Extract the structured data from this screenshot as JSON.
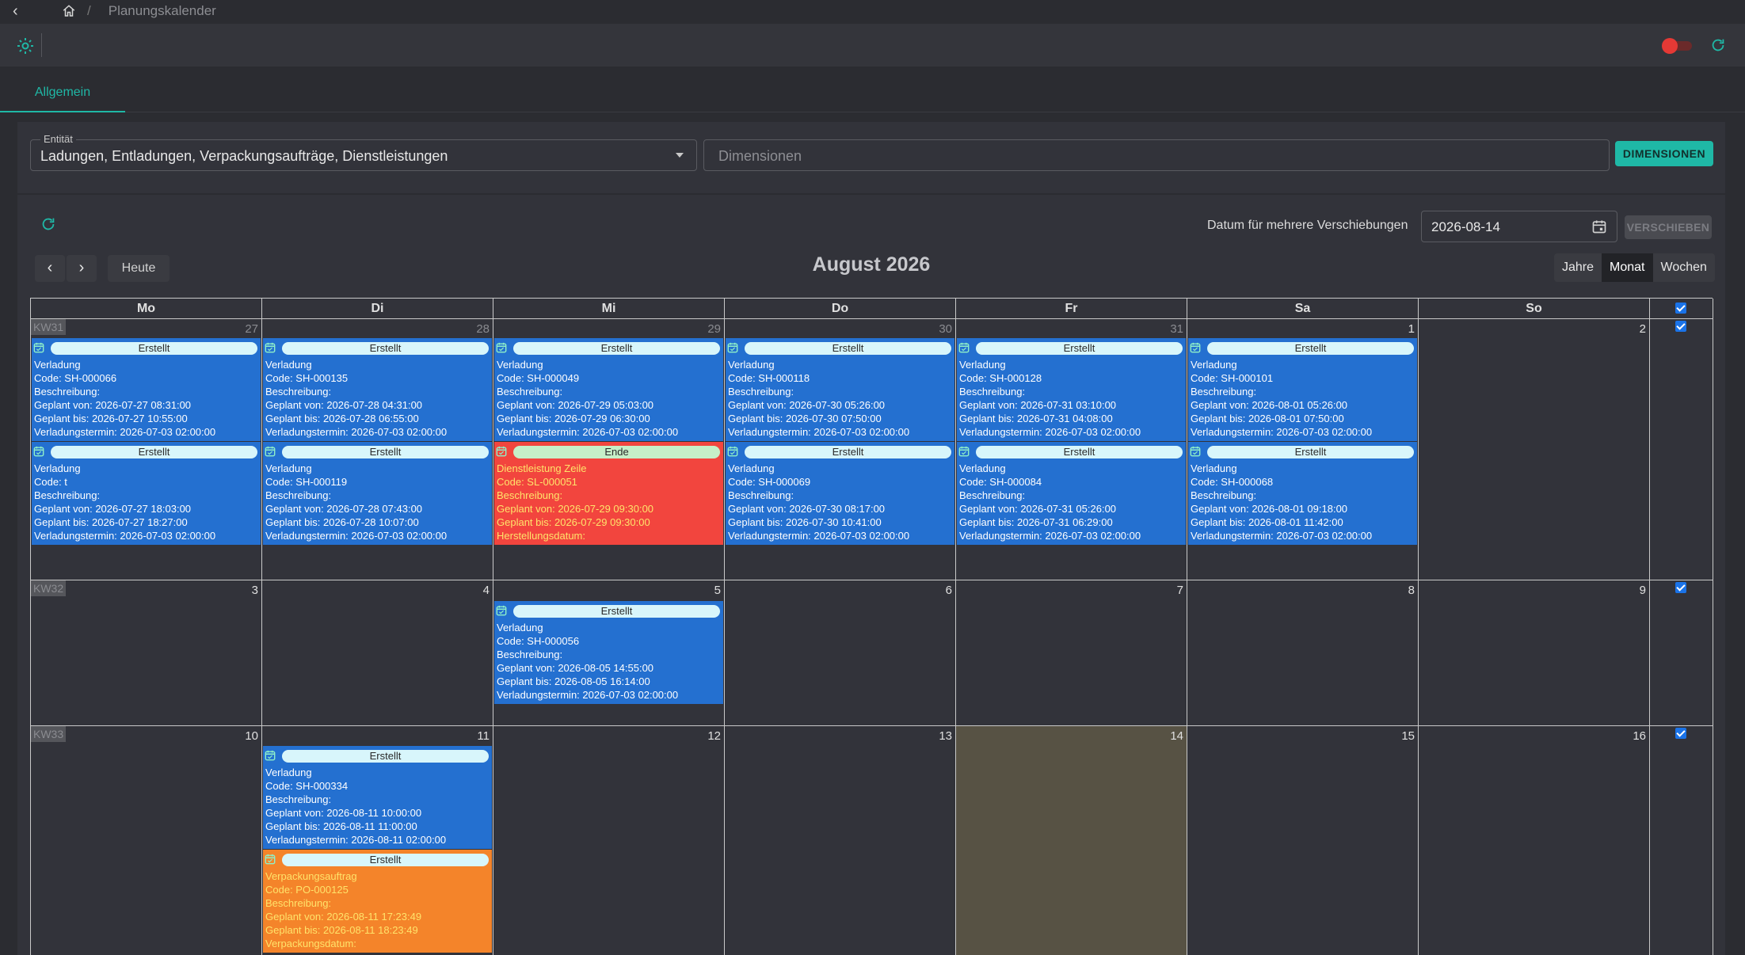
{
  "breadcrumb": {
    "current": "Planungskalender",
    "separator": "/"
  },
  "tabs": [
    {
      "label": "Allgemein",
      "active": true
    }
  ],
  "filters": {
    "entity_label": "Entität",
    "entity_value": "Ladungen, Entladungen, Verpackungsaufträge, Dienstleistungen",
    "dimensions_placeholder": "Dimensionen",
    "dimensions_button": "DIMENSIONEN"
  },
  "shift": {
    "label": "Datum für mehrere Verschiebungen",
    "date_value": "2026-08-14",
    "button": "VERSCHIEBEN"
  },
  "nav": {
    "today": "Heute",
    "title": "August 2026"
  },
  "views": [
    {
      "label": "Jahre"
    },
    {
      "label": "Monat",
      "active": true
    },
    {
      "label": "Wochen"
    }
  ],
  "weekdays": [
    "Mo",
    "Di",
    "Mi",
    "Do",
    "Fr",
    "Sa",
    "So"
  ],
  "weeks": [
    {
      "kw": "KW31",
      "days": [
        "27",
        "28",
        "29",
        "30",
        "31",
        "1",
        "2"
      ]
    },
    {
      "kw": "KW32",
      "days": [
        "3",
        "4",
        "5",
        "6",
        "7",
        "8",
        "9"
      ]
    },
    {
      "kw": "KW33",
      "days": [
        "10",
        "11",
        "12",
        "13",
        "14",
        "15",
        "16"
      ]
    }
  ],
  "events": [
    {
      "status": "Erstellt",
      "lines": [
        "Verladung",
        "Code: SH-000066",
        "Beschreibung:",
        "Geplant von: 2026-07-27 08:31:00",
        "Geplant bis: 2026-07-27 10:55:00",
        "Verladungstermin: 2026-07-03 02:00:00"
      ]
    },
    {
      "status": "Erstellt",
      "lines": [
        "Verladung",
        "Code: SH-000135",
        "Beschreibung:",
        "Geplant von: 2026-07-28 04:31:00",
        "Geplant bis: 2026-07-28 06:55:00",
        "Verladungstermin: 2026-07-03 02:00:00"
      ]
    },
    {
      "status": "Erstellt",
      "lines": [
        "Verladung",
        "Code: SH-000049",
        "Beschreibung:",
        "Geplant von: 2026-07-29 05:03:00",
        "Geplant bis: 2026-07-29 06:30:00",
        "Verladungstermin: 2026-07-03 02:00:00"
      ]
    },
    {
      "status": "Erstellt",
      "lines": [
        "Verladung",
        "Code: SH-000118",
        "Beschreibung:",
        "Geplant von: 2026-07-30 05:26:00",
        "Geplant bis: 2026-07-30 07:50:00",
        "Verladungstermin: 2026-07-03 02:00:00"
      ]
    },
    {
      "status": "Erstellt",
      "lines": [
        "Verladung",
        "Code: SH-000128",
        "Beschreibung:",
        "Geplant von: 2026-07-31 03:10:00",
        "Geplant bis: 2026-07-31 04:08:00",
        "Verladungstermin: 2026-07-03 02:00:00"
      ]
    },
    {
      "status": "Erstellt",
      "lines": [
        "Verladung",
        "Code: SH-000101",
        "Beschreibung:",
        "Geplant von: 2026-08-01 05:26:00",
        "Geplant bis: 2026-08-01 07:50:00",
        "Verladungstermin: 2026-07-03 02:00:00"
      ]
    },
    {
      "status": "Erstellt",
      "lines": [
        "Verladung",
        "Code: t",
        "Beschreibung:",
        "Geplant von: 2026-07-27 18:03:00",
        "Geplant bis: 2026-07-27 18:27:00",
        "Verladungstermin: 2026-07-03 02:00:00"
      ]
    },
    {
      "status": "Erstellt",
      "lines": [
        "Verladung",
        "Code: SH-000119",
        "Beschreibung:",
        "Geplant von: 2026-07-28 07:43:00",
        "Geplant bis: 2026-07-28 10:07:00",
        "Verladungstermin: 2026-07-03 02:00:00"
      ]
    },
    {
      "status": "Ende",
      "lines": [
        "Dienstleistung Zeile",
        "Code: SL-000051",
        "Beschreibung:",
        "Geplant von: 2026-07-29 09:30:00",
        "Geplant bis: 2026-07-29 09:30:00",
        "Herstellungsdatum:"
      ]
    },
    {
      "status": "Erstellt",
      "lines": [
        "Verladung",
        "Code: SH-000069",
        "Beschreibung:",
        "Geplant von: 2026-07-30 08:17:00",
        "Geplant bis: 2026-07-30 10:41:00",
        "Verladungstermin: 2026-07-03 02:00:00"
      ]
    },
    {
      "status": "Erstellt",
      "lines": [
        "Verladung",
        "Code: SH-000084",
        "Beschreibung:",
        "Geplant von: 2026-07-31 05:26:00",
        "Geplant bis: 2026-07-31 06:29:00",
        "Verladungstermin: 2026-07-03 02:00:00"
      ]
    },
    {
      "status": "Erstellt",
      "lines": [
        "Verladung",
        "Code: SH-000068",
        "Beschreibung:",
        "Geplant von: 2026-08-01 09:18:00",
        "Geplant bis: 2026-08-01 11:42:00",
        "Verladungstermin: 2026-07-03 02:00:00"
      ]
    },
    {
      "status": "Erstellt",
      "lines": [
        "Verladung",
        "Code: SH-000056",
        "Beschreibung:",
        "Geplant von: 2026-08-05 14:55:00",
        "Geplant bis: 2026-08-05 16:14:00",
        "Verladungstermin: 2026-07-03 02:00:00"
      ]
    },
    {
      "status": "Erstellt",
      "lines": [
        "Verladung",
        "Code: SH-000334",
        "Beschreibung:",
        "Geplant von: 2026-08-11 10:00:00",
        "Geplant bis: 2026-08-11 11:00:00",
        "Verladungstermin: 2026-08-11 02:00:00"
      ]
    },
    {
      "status": "Erstellt",
      "lines": [
        "Verpackungsauftrag",
        "Code: PO-000125",
        "Beschreibung:",
        "Geplant von: 2026-08-11 17:23:49",
        "Geplant bis: 2026-08-11 18:23:49",
        "Verpackungsdatum:"
      ]
    }
  ],
  "colors": {
    "accent": "#1fb8a6",
    "event_blue": "#2470d0",
    "event_red": "#f2453e",
    "event_orange": "#f4842a",
    "today": "#575244"
  }
}
